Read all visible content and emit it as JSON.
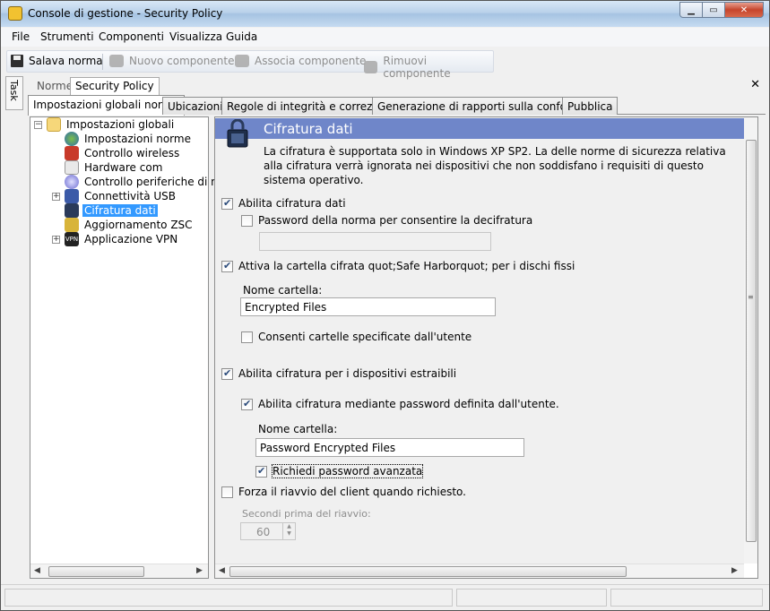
{
  "window": {
    "title": "Console di gestione  - Security Policy"
  },
  "menu": {
    "items": [
      "File",
      "Strumenti",
      "Componenti",
      "Visualizza",
      "Guida"
    ]
  },
  "toolbar": {
    "save_label": "Salava norma",
    "new_label": "Nuovo componente",
    "assoc_label": "Associa componente",
    "remove_label": "Rimuovi componente"
  },
  "side": {
    "task_label": "Task"
  },
  "doc_tabs": {
    "norme": "Norme",
    "security_policy": "Security Policy"
  },
  "inner_tabs": [
    "Impostazioni globali norme",
    "Ubicazioni",
    "Regole di integrità e correzione",
    "Generazione di rapporti sulla conformità",
    "Pubblica"
  ],
  "tree": {
    "root": "Impostazioni globali",
    "items": [
      "Impostazioni norme",
      "Controllo wireless",
      "Hardware com",
      "Controllo periferiche di me",
      "Connettività USB",
      "Cifratura dati",
      "Aggiornamento ZSC",
      "Applicazione VPN"
    ],
    "selected": "Cifratura dati"
  },
  "content": {
    "title": "Cifratura dati",
    "description": "La cifratura è supportata solo in Windows XP SP2. La delle norme di sicurezza relativa alla cifratura verrà ignorata nei dispositivi che non soddisfano i requisiti di questo sistema operativo.",
    "enable_encryption": "Abilita cifratura dati",
    "policy_password": "Password della norma per consentire la decifratura",
    "policy_password_value": "",
    "safe_harbor": "Attiva la cartella cifrata quot;Safe Harborquot; per i dischi fissi",
    "folder_name_label": "Nome cartella:",
    "folder_name_value": "Encrypted Files",
    "allow_user_folders": "Consenti cartelle specificate dall'utente",
    "removable": "Abilita cifratura per i dispositivi estraibili",
    "user_password": "Abilita cifratura mediante password definita dall'utente.",
    "folder_name_label2": "Nome cartella:",
    "folder_name_value2": "Password Encrypted Files",
    "strong_password": "Richiedi password avanzata",
    "force_reboot": "Forza il riavvio del client quando richiesto.",
    "seconds_label": "Secondi prima del riavvio:",
    "seconds_value": "60"
  },
  "states": {
    "enable_encryption": true,
    "policy_password": false,
    "safe_harbor": true,
    "allow_user_folders": false,
    "removable": true,
    "user_password": true,
    "strong_password": true,
    "force_reboot": false
  }
}
